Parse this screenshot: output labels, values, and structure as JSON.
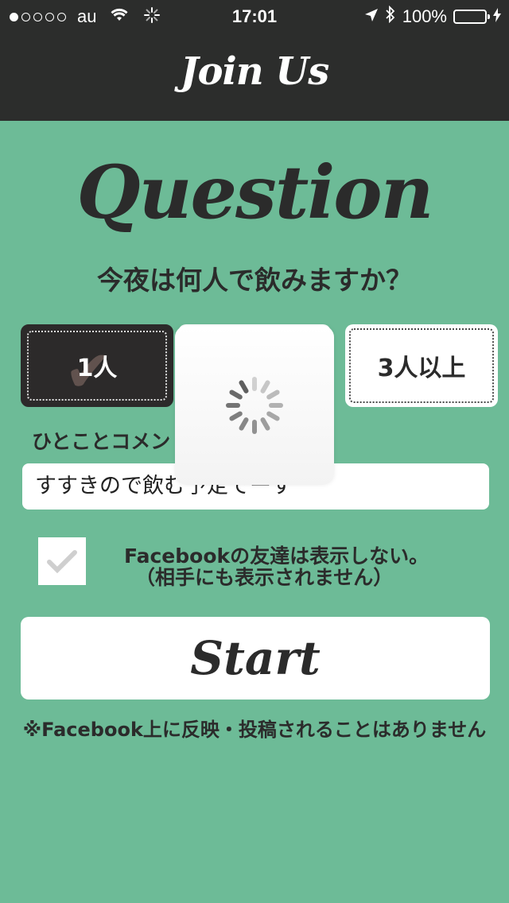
{
  "status_bar": {
    "carrier": "au",
    "time": "17:01",
    "battery": "100%",
    "signal_bars": 1,
    "signal_total": 5
  },
  "nav": {
    "title": "Join Us"
  },
  "heading": "Question",
  "question": "今夜は何人で飲みますか？",
  "options": [
    {
      "label": "1人",
      "selected": true
    },
    {
      "label": "",
      "selected": false
    },
    {
      "label": "3人以上",
      "selected": false
    }
  ],
  "comment": {
    "label": "ひとことコメン",
    "value": "すすきので飲む予定でーす"
  },
  "checkbox": {
    "line1": "Facebookの友達は表示しない。",
    "line2": "（相手にも表示されません）",
    "checked": true
  },
  "start_button": "Start",
  "notice": "※Facebook上に反映・投稿されることはありません",
  "colors": {
    "background": "#6dbb97",
    "bar": "#2c2d2c",
    "battery": "#4cd964"
  },
  "icons": [
    "wifi-icon",
    "activity-spinner-icon",
    "location-arrow-icon",
    "bluetooth-icon",
    "battery-icon",
    "charging-icon",
    "checkmark-icon",
    "loading-spinner-icon"
  ]
}
